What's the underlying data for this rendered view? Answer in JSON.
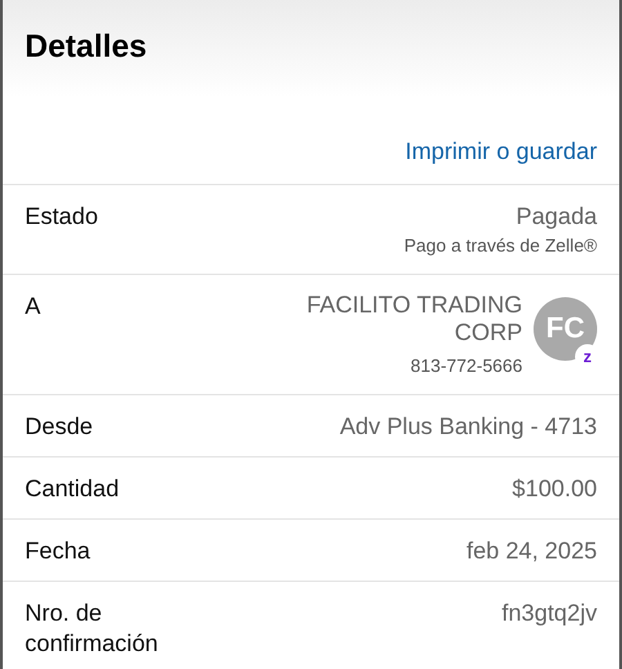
{
  "header": {
    "title": "Detalles"
  },
  "action": {
    "label": "Imprimir o guardar"
  },
  "rows": [
    {
      "kind": "status",
      "label": "Estado",
      "value": "Pagada",
      "note": "Pago a través de Zelle®"
    },
    {
      "kind": "recipient",
      "label": "A",
      "value": "FACILITO TRADING CORP",
      "note": "813-772-5666",
      "avatar": {
        "initials": "FC",
        "badge": "z"
      }
    },
    {
      "kind": "plain",
      "label": "Desde",
      "value": "Adv Plus Banking - 4713"
    },
    {
      "kind": "plain",
      "label": "Cantidad",
      "value": "$100.00"
    },
    {
      "kind": "plain",
      "label": "Fecha",
      "value": "feb 24, 2025"
    },
    {
      "kind": "plain",
      "label": "Nro. de confirmación",
      "value": "fn3gtq2jv"
    }
  ]
}
